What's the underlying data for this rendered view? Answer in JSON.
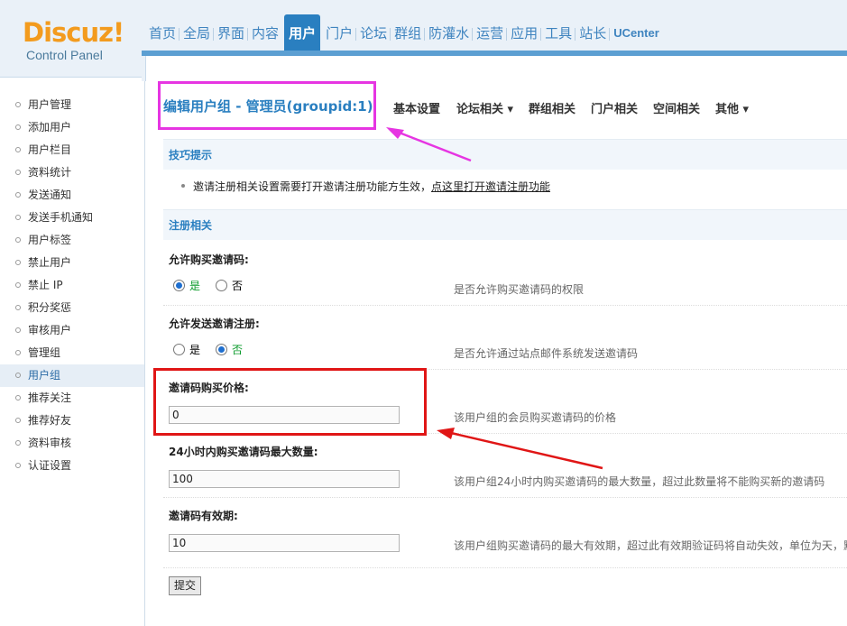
{
  "logo": {
    "name": "Discuz!",
    "subtitle": "Control Panel"
  },
  "topnav": [
    {
      "label": "首页"
    },
    {
      "label": "全局"
    },
    {
      "label": "界面"
    },
    {
      "label": "内容"
    },
    {
      "label": "用户",
      "active": true
    },
    {
      "label": "门户"
    },
    {
      "label": "论坛"
    },
    {
      "label": "群组"
    },
    {
      "label": "防灌水"
    },
    {
      "label": "运营"
    },
    {
      "label": "应用"
    },
    {
      "label": "工具"
    },
    {
      "label": "站长"
    },
    {
      "label": "UCenter"
    }
  ],
  "sidebar": {
    "items": [
      {
        "label": "用户管理"
      },
      {
        "label": "添加用户"
      },
      {
        "label": "用户栏目"
      },
      {
        "label": "资料统计"
      },
      {
        "label": "发送通知"
      },
      {
        "label": "发送手机通知"
      },
      {
        "label": "用户标签"
      },
      {
        "label": "禁止用户"
      },
      {
        "label": "禁止 IP"
      },
      {
        "label": "积分奖惩"
      },
      {
        "label": "审核用户"
      },
      {
        "label": "管理组"
      },
      {
        "label": "用户组",
        "active": true
      },
      {
        "label": "推荐关注"
      },
      {
        "label": "推荐好友"
      },
      {
        "label": "资料审核"
      },
      {
        "label": "认证设置"
      }
    ]
  },
  "page": {
    "title": "编辑用户组 - 管理员(groupid:1)",
    "subtabs": [
      "基本设置",
      "论坛相关 ▾",
      "群组相关",
      "门户相关",
      "空间相关",
      "其他 ▾"
    ]
  },
  "tips": {
    "heading": "技巧提示",
    "text": "邀请注册相关设置需要打开邀请注册功能方生效，",
    "link": "点这里打开邀请注册功能"
  },
  "register": {
    "heading": "注册相关",
    "buy_invite": {
      "label": "允许购买邀请码:",
      "yes": "是",
      "no": "否",
      "selected": "yes",
      "desc": "是否允许购买邀请码的权限"
    },
    "send_invite": {
      "label": "允许发送邀请注册:",
      "yes": "是",
      "no": "否",
      "selected": "no",
      "desc": "是否允许通过站点邮件系统发送邀请码"
    },
    "invite_price": {
      "label": "邀请码购买价格:",
      "value": "0",
      "desc": "该用户组的会员购买邀请码的价格"
    },
    "max_buy_24h": {
      "label": "24小时内购买邀请码最大数量:",
      "value": "100",
      "desc": "该用户组24小时内购买邀请码的最大数量，超过此数量将不能购买新的邀请码"
    },
    "invite_expire": {
      "label": "邀请码有效期:",
      "value": "10",
      "desc": "该用户组购买邀请码的最大有效期，超过此有效期验证码将自动失效，单位为天，默"
    }
  },
  "submit_label": "提交",
  "colors": {
    "accent": "#2a7fc0",
    "logo_orange": "#f39b1e",
    "annotation_magenta": "#e635e2",
    "annotation_red": "#e01616"
  }
}
